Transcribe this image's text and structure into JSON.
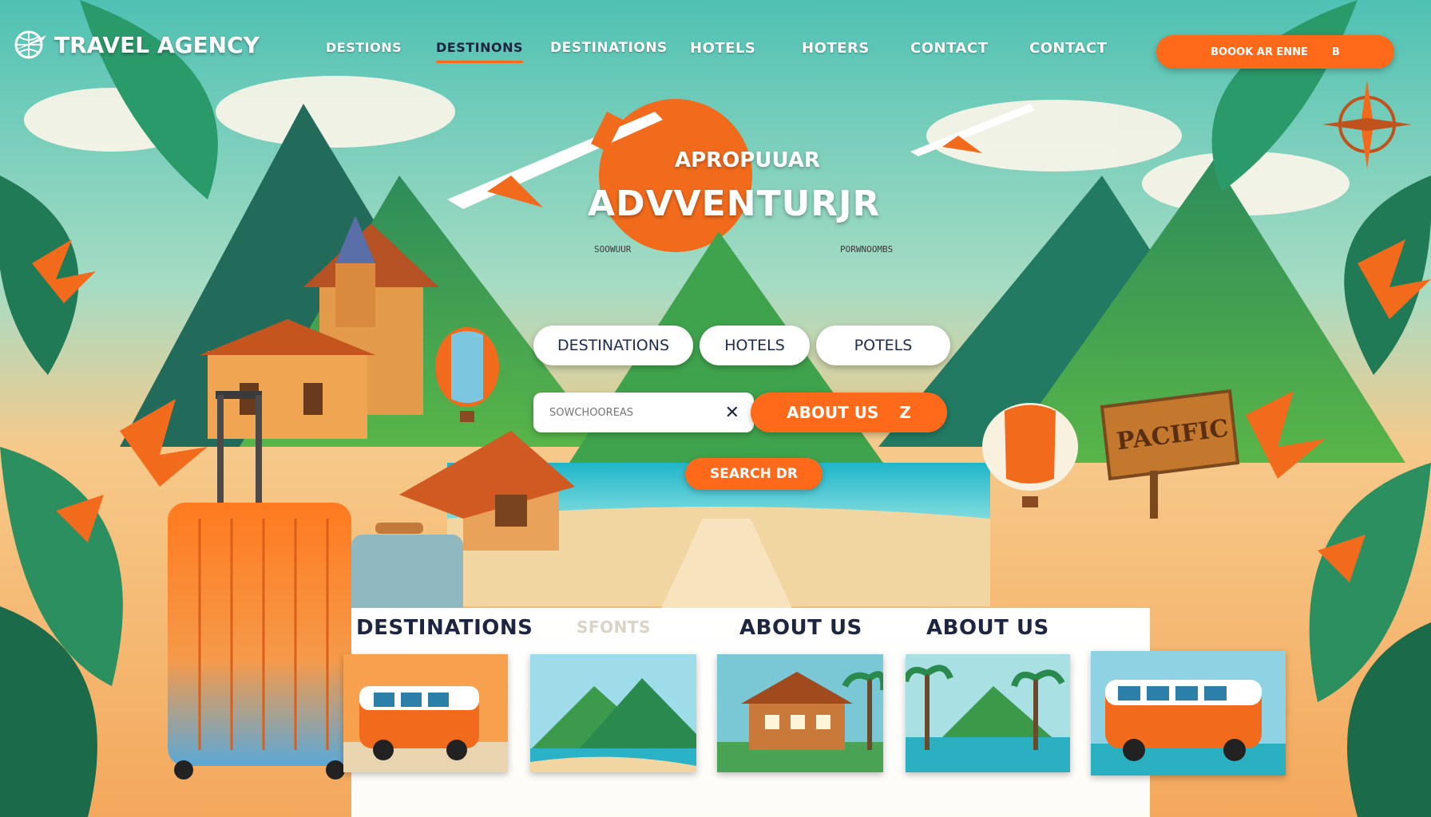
{
  "brand": {
    "name": "TRAVEL AGENCY",
    "logo_icon": "globe-plane-icon"
  },
  "nav": {
    "items": [
      {
        "label": "DESTIONS",
        "active": false
      },
      {
        "label": "DESTINONS",
        "active": true
      },
      {
        "label": "DESTINATIONS",
        "active": false
      },
      {
        "label": "HOTELS",
        "active": false
      },
      {
        "label": "HOTERS",
        "active": false
      },
      {
        "label": "CONTACT",
        "active": false
      },
      {
        "label": "CONTACT",
        "active": false
      }
    ],
    "cta": {
      "label": "BOOOK AR ENNE",
      "suffix": "B"
    }
  },
  "hero": {
    "kicker": "APROPUUAR",
    "headline": "ADVVENTURJR",
    "left_sub": "SOOWUUR",
    "right_sub": "PORWNOOMBS",
    "sign_text": "PACIFIC"
  },
  "filters": {
    "destinations": "DESTINATIONS",
    "hotels": "HOTELS",
    "potels": "POTELS"
  },
  "search": {
    "placeholder": "SOWCHOOREAS",
    "clear_icon": "close-icon",
    "about_button": "ABOUT US",
    "about_suffix": "Z",
    "submit_button": "SEARCH DR"
  },
  "sections": {
    "labels": [
      "DESTINATIONS",
      "SFONTS",
      "ABOUT US",
      "ABOUT US"
    ]
  },
  "cards": [
    {
      "name": "orange-van-card"
    },
    {
      "name": "mountain-coast-card"
    },
    {
      "name": "tropical-house-card"
    },
    {
      "name": "lagoon-palms-card"
    },
    {
      "name": "beach-van-card"
    }
  ],
  "colors": {
    "accent": "#ff6a1a",
    "teal": "#2bb3a0",
    "sky": "#8fd6d0",
    "navy": "#1d2540"
  }
}
